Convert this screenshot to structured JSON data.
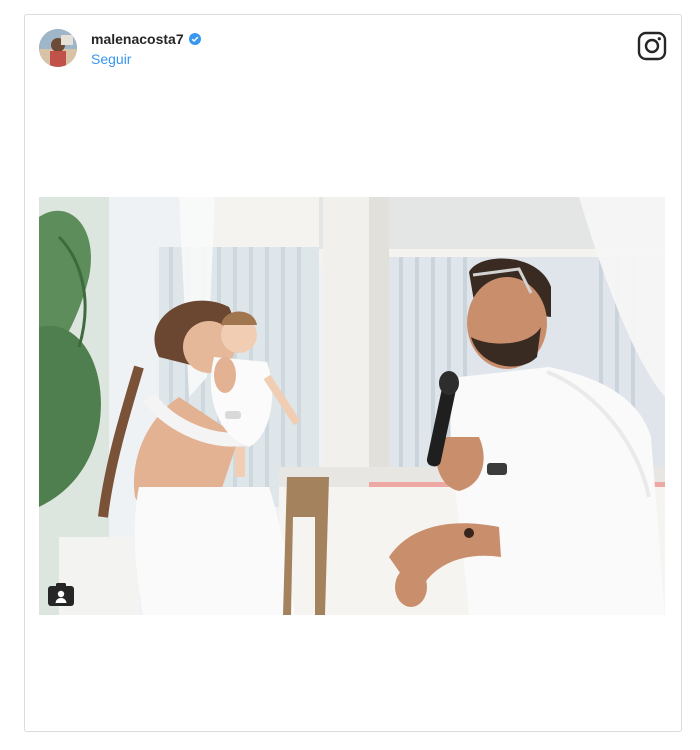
{
  "post": {
    "username": "malenacosta7",
    "follow_label": "Seguir",
    "verified": true
  },
  "icons": {
    "verified": "verified-badge-icon",
    "platform": "instagram-icon",
    "camera": "camera-person-icon"
  },
  "colors": {
    "follow_link": "#3897f0",
    "verified_badge": "#3897f0",
    "username": "#262626"
  }
}
